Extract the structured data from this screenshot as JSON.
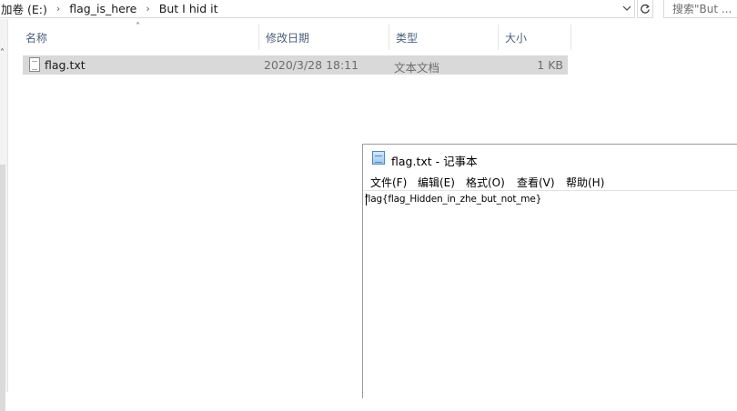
{
  "address_bar": {
    "crumbs": [
      "加卷 (E:)",
      "flag_is_here",
      "But I hid it"
    ],
    "search_placeholder": "搜索\"But ..."
  },
  "columns": {
    "name": "名称",
    "modified": "修改日期",
    "type": "类型",
    "size": "大小"
  },
  "files": [
    {
      "name": "flag.txt",
      "modified": "2020/3/28 18:11",
      "type": "文本文档",
      "size": "1 KB"
    }
  ],
  "notepad": {
    "title": "flag.txt - 记事本",
    "menu": [
      "文件(F)",
      "编辑(E)",
      "格式(O)",
      "查看(V)",
      "帮助(H)"
    ],
    "content": "flag{flag_Hidden_in_zhe_but_not_me}"
  },
  "colors": {
    "selection": "#d9d9d9",
    "header_text": "#4c607a",
    "border": "#d9d9d9"
  },
  "icons": [
    "chevron-right-icon",
    "chevron-down-icon",
    "refresh-icon",
    "text-file-icon",
    "notepad-icon",
    "sort-up-icon"
  ]
}
